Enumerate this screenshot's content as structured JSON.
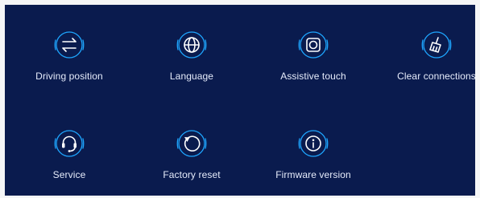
{
  "settings": {
    "items": [
      {
        "label": "Driving position",
        "icon": "swap-arrows-icon"
      },
      {
        "label": "Language",
        "icon": "globe-icon"
      },
      {
        "label": "Assistive touch",
        "icon": "assistive-touch-icon"
      },
      {
        "label": "Clear connections",
        "icon": "broom-icon"
      },
      {
        "label": "Service",
        "icon": "headset-icon"
      },
      {
        "label": "Factory reset",
        "icon": "reset-icon"
      },
      {
        "label": "Firmware version",
        "icon": "info-icon"
      }
    ]
  },
  "colors": {
    "background": "#0a1b4e",
    "accent": "#1ea6ff",
    "text": "#e6ecfb"
  }
}
